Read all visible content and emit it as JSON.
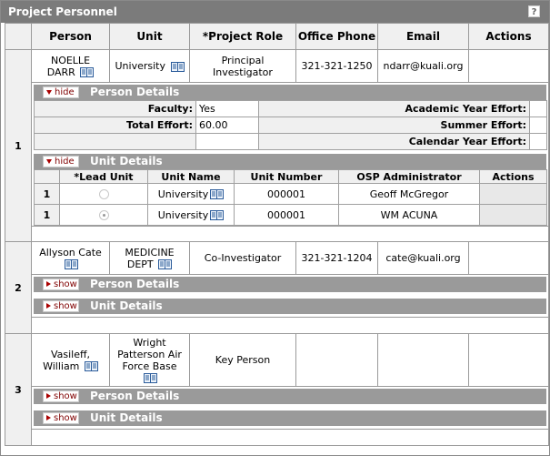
{
  "panel": {
    "title": "Project Personnel",
    "help_glyph": "?"
  },
  "headers": {
    "person": "Person",
    "unit": "Unit",
    "role": "*Project Role",
    "phone": "Office Phone",
    "email": "Email",
    "actions": "Actions"
  },
  "toggle": {
    "hide": "hide",
    "show": "show"
  },
  "sections": {
    "person_details": "Person Details",
    "unit_details": "Unit Details"
  },
  "person_details_labels": {
    "faculty": "Faculty:",
    "total_effort": "Total Effort:",
    "academic_year": "Academic Year Effort:",
    "summer": "Summer Effort:",
    "calendar_year": "Calendar Year Effort:"
  },
  "unit_headers": {
    "lead_unit": "*Lead Unit",
    "unit_name": "Unit Name",
    "unit_number": "Unit Number",
    "osp_admin": "OSP Administrator",
    "actions": "Actions"
  },
  "people": [
    {
      "num": "1",
      "name_line1": "NOELLE",
      "name_line2": "DARR",
      "unit": "University",
      "role": "Principal Investigator",
      "phone": "321-321-1250",
      "email": "ndarr@kuali.org",
      "expanded": true,
      "details": {
        "faculty": "Yes",
        "total_effort": "60.00"
      },
      "units": [
        {
          "num": "1",
          "lead": false,
          "name": "University",
          "number": "000001",
          "admin": "Geoff McGregor"
        },
        {
          "num": "1",
          "lead": true,
          "name": "University",
          "number": "000001",
          "admin": "WM ACUNA"
        }
      ]
    },
    {
      "num": "2",
      "name_line1": "Allyson Cate",
      "unit_line1": "MEDICINE",
      "unit_line2": "DEPT",
      "role": "Co-Investigator",
      "phone": "321-321-1204",
      "email": "cate@kuali.org",
      "expanded": false
    },
    {
      "num": "3",
      "name_line1": "Vasileff,",
      "name_line2": "William",
      "unit_line1": "Wright",
      "unit_line2": "Patterson Air",
      "unit_line3": "Force Base",
      "role": "Key Person",
      "phone": "",
      "email": "",
      "expanded": false
    }
  ],
  "colors": {
    "title_bar": "#7b7b7b",
    "section_bar": "#9a9a9a",
    "header_bg": "#f0f0f0",
    "toggle_text": "#800000"
  }
}
